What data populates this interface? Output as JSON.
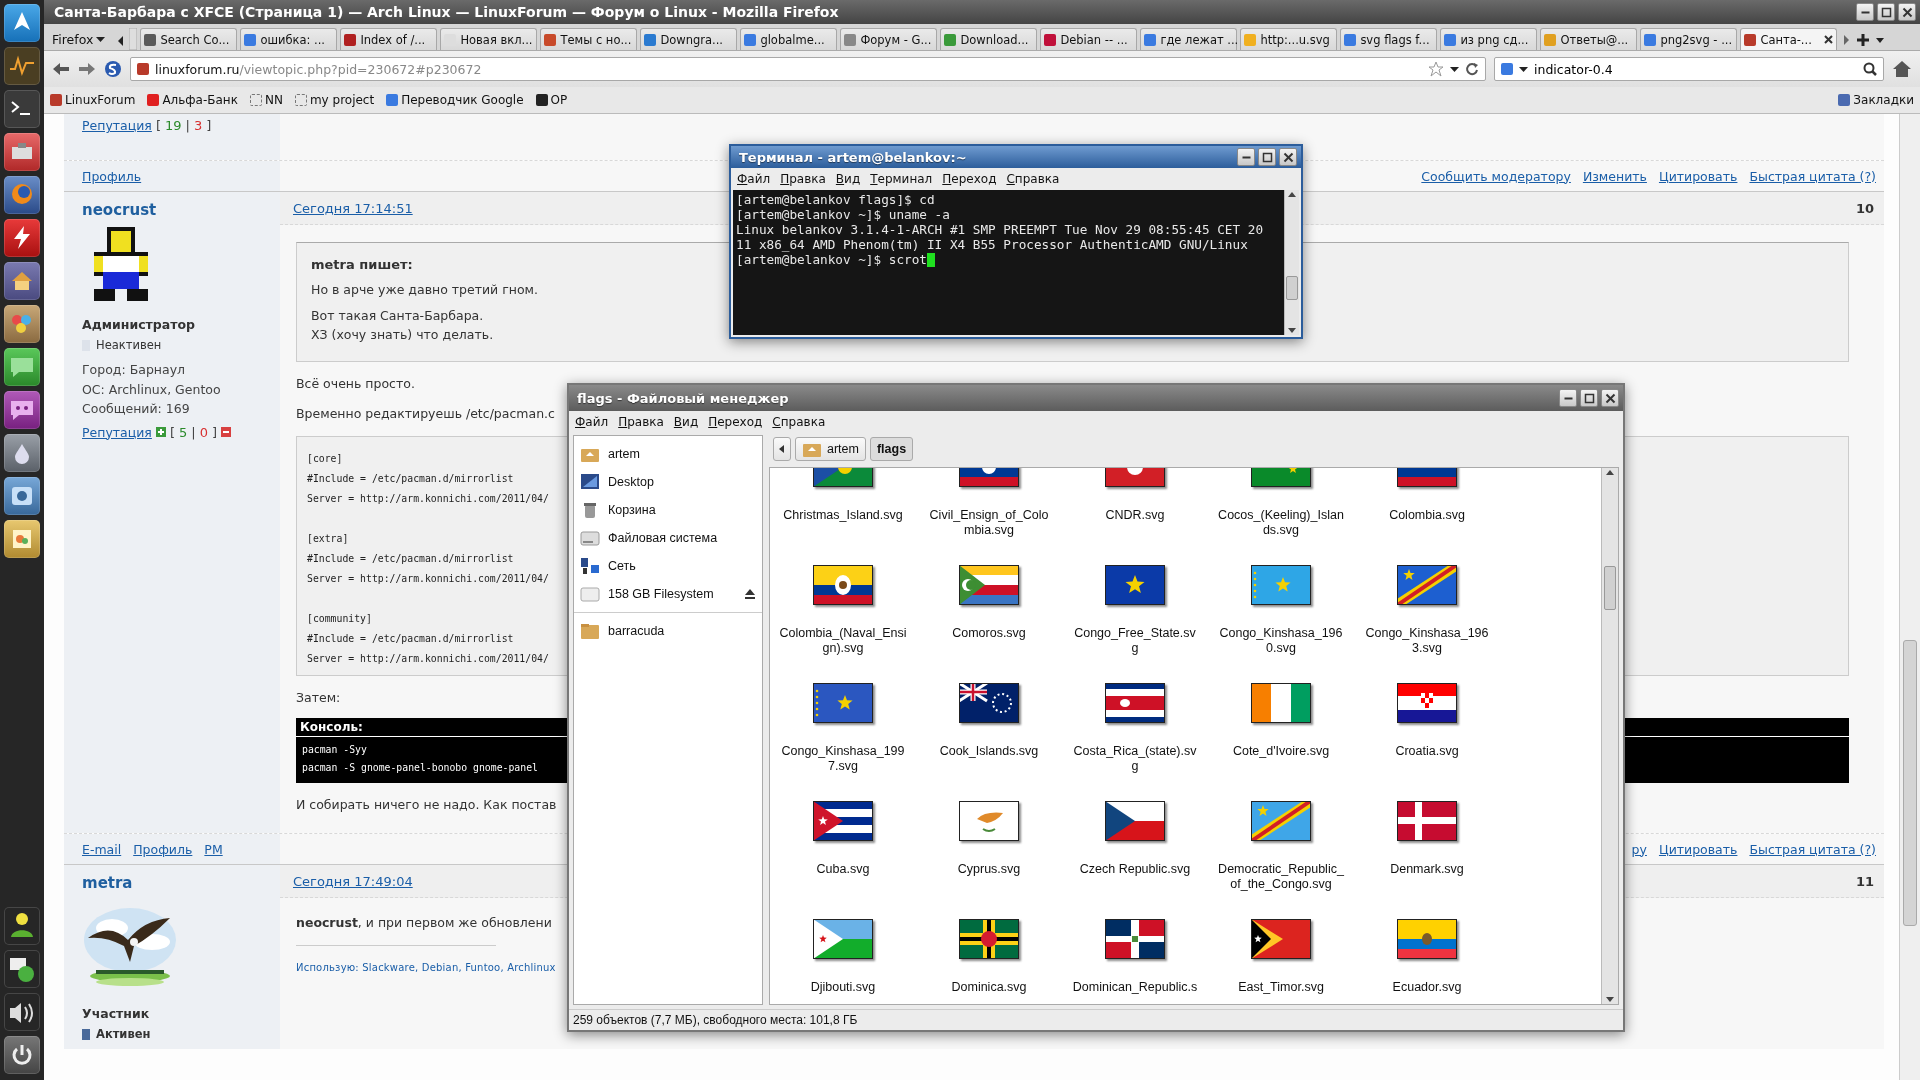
{
  "window": {
    "title": "Санта-Барбара с XFCE (Страница 1) — Arch Linux — LinuxForum — Форум о Linux - Mozilla Firefox"
  },
  "browser": {
    "menu_button": "Firefox",
    "tabs": [
      {
        "label": "Search Co...",
        "selected": false
      },
      {
        "label": "ошибка: ...",
        "selected": false
      },
      {
        "label": "Index of /...",
        "selected": false
      },
      {
        "label": "Новая вкл...",
        "selected": false
      },
      {
        "label": "Темы с но...",
        "selected": false
      },
      {
        "label": "Downgra...",
        "selected": false
      },
      {
        "label": "globalme...",
        "selected": false
      },
      {
        "label": "Форум - G...",
        "selected": false
      },
      {
        "label": "Download...",
        "selected": false
      },
      {
        "label": "Debian -- ...",
        "selected": false
      },
      {
        "label": "где лежат ...",
        "selected": false
      },
      {
        "label": "http:...u.svg",
        "selected": false
      },
      {
        "label": "svg flags f...",
        "selected": false
      },
      {
        "label": "из png сд...",
        "selected": false
      },
      {
        "label": "Ответы@...",
        "selected": false
      },
      {
        "label": "png2svg - ...",
        "selected": false
      },
      {
        "label": "Санта-...",
        "selected": true
      }
    ],
    "url": {
      "host": "linuxforum.ru",
      "path": "/viewtopic.php?pid=230672#p230672"
    },
    "search": "indicator-0.4",
    "bookmarks": [
      "LinuxForum",
      "Альфа-Банк",
      "NN",
      "my project",
      "Переводчик Google",
      "OP"
    ],
    "bookmarks_menu": "Закладки"
  },
  "forum": {
    "prev_post": {
      "reputation": {
        "label": "Репутация",
        "plus": "19",
        "minus": "3",
        "brackets": [
          "[",
          "|",
          "]"
        ],
        "vote_buttons": false
      },
      "footer_left": [
        "Профиль"
      ],
      "footer_right": [
        "Сообщить модератору",
        "Изменить",
        "Цитировать",
        "Быстрая цитата (?)"
      ]
    },
    "posts": [
      {
        "number": "10",
        "date": "Сегодня 17:14:51",
        "author": "neocrust",
        "avatar": {
          "kind": "pixel"
        },
        "role": "Администратор",
        "status": {
          "label": "Неактивен",
          "active": false
        },
        "info": [
          "Город: Барнаул",
          "ОС: Archlinux, Gentoo",
          "Сообщений: 169"
        ],
        "reputation": {
          "label": "Репутация",
          "plus": "5",
          "minus": "0",
          "brackets": [
            "[",
            "|",
            "]"
          ],
          "vote_buttons": true
        },
        "body": [
          {
            "kind": "quote",
            "author_line": "metra пишет:",
            "paragraphs": [
              [
                "Но в арче уже давно третий гном."
              ],
              [
                "Вот такая Санта-Барбара.",
                "ХЗ (хочу знать) что делать."
              ]
            ]
          },
          {
            "kind": "text",
            "text": "Всё очень просто."
          },
          {
            "kind": "text",
            "text": "Временно редактируешь /etc/pacman.c"
          },
          {
            "kind": "code",
            "groups": [
              [
                "[core]",
                "#Include = /etc/pacman.d/mirrorlist",
                "Server = http://arm.konnichi.com/2011/04/"
              ],
              [
                "[extra]",
                "#Include = /etc/pacman.d/mirrorlist",
                "Server = http://arm.konnichi.com/2011/04/"
              ],
              [
                "[community]",
                "#Include = /etc/pacman.d/mirrorlist",
                "Server = http://arm.konnichi.com/2011/04/"
              ]
            ]
          },
          {
            "kind": "text",
            "text": "Затем:"
          },
          {
            "kind": "console",
            "title": "Консоль:",
            "lines": [
              "pacman -Syy",
              "pacman -S gnome-panel-bonobo gnome-panel"
            ]
          },
          {
            "kind": "text",
            "text": "И собирать ничего не надо. Как постав"
          }
        ],
        "footer_left": [
          "E-mail",
          "Профиль",
          "PM"
        ],
        "footer_right": [
          "ру",
          "Цитировать",
          "Быстрая цитата (?)"
        ]
      },
      {
        "number": "11",
        "date": "Сегодня 17:49:04",
        "author": "metra",
        "avatar": {
          "kind": "picture"
        },
        "role": "Участник",
        "status": {
          "label": "Активен",
          "active": true
        },
        "body": [
          {
            "kind": "text",
            "text": "**neocrust**, и при первом же обновлени"
          },
          {
            "kind": "signature",
            "text": "Использую: Slackware, Debian, Funtoo, Archlinux"
          }
        ]
      }
    ]
  },
  "terminal": {
    "title": "Терминал - artem@belankov:~",
    "active": true,
    "menu": [
      "Файл",
      "Правка",
      "Вид",
      "Терминал",
      "Переход",
      "Справка"
    ],
    "lines": [
      "[artem@belankov flags]$ cd",
      "[artem@belankov ~]$ uname -a",
      "Linux belankov 3.1.4-1-ARCH #1 SMP PREEMPT Tue Nov 29 08:55:45 CET 20",
      "11 x86_64 AMD Phenom(tm) II X4 B55 Processor AuthenticAMD GNU/Linux",
      "[artem@belankov ~]$ scrot"
    ]
  },
  "file_manager": {
    "title": "flags - Файловый менеджер",
    "active": false,
    "menu": [
      "Файл",
      "Правка",
      "Вид",
      "Переход",
      "Справка"
    ],
    "places": [
      {
        "label": "artem",
        "kind": "home",
        "ejectable": false
      },
      {
        "label": "Desktop",
        "kind": "desktop",
        "ejectable": false
      },
      {
        "label": "Корзина",
        "kind": "trash",
        "ejectable": false
      },
      {
        "label": "Файловая система",
        "kind": "filesystem",
        "ejectable": false
      },
      {
        "label": "Сеть",
        "kind": "network",
        "ejectable": false
      },
      {
        "label": "158 GB Filesystem",
        "kind": "drive",
        "ejectable": true
      }
    ],
    "bookmarks": [
      {
        "label": "barracuda",
        "kind": "folder",
        "ejectable": false
      }
    ],
    "path": [
      {
        "label": "artem",
        "selected": false
      },
      {
        "label": "flags",
        "selected": true
      }
    ],
    "files": [
      "Christmas_Island.svg",
      "Civil_Ensign_of_Colombia.svg",
      "CNDR.svg",
      "Cocos_(Keeling)_Islands.svg",
      "Colombia.svg",
      "Colombia_(Naval_Ensign).svg",
      "Comoros.svg",
      "Congo_Free_State.svg",
      "Congo_Kinshasa_1960.svg",
      "Congo_Kinshasa_1963.svg",
      "Congo_Kinshasa_1997.svg",
      "Cook_Islands.svg",
      "Costa_Rica_(state).svg",
      "Cote_d'Ivoire.svg",
      "Croatia.svg",
      "Cuba.svg",
      "Cyprus.svg",
      "Czech Republic.svg",
      "Democratic_Republic_of_the_Congo.svg",
      "Denmark.svg",
      "Djibouti.svg",
      "Dominica.svg",
      "Dominican_Republic.s",
      "East_Timor.svg",
      "Ecuador.svg"
    ],
    "status": "259 объектов (7,7 МБ), свободного места: 101,8 ГБ"
  }
}
